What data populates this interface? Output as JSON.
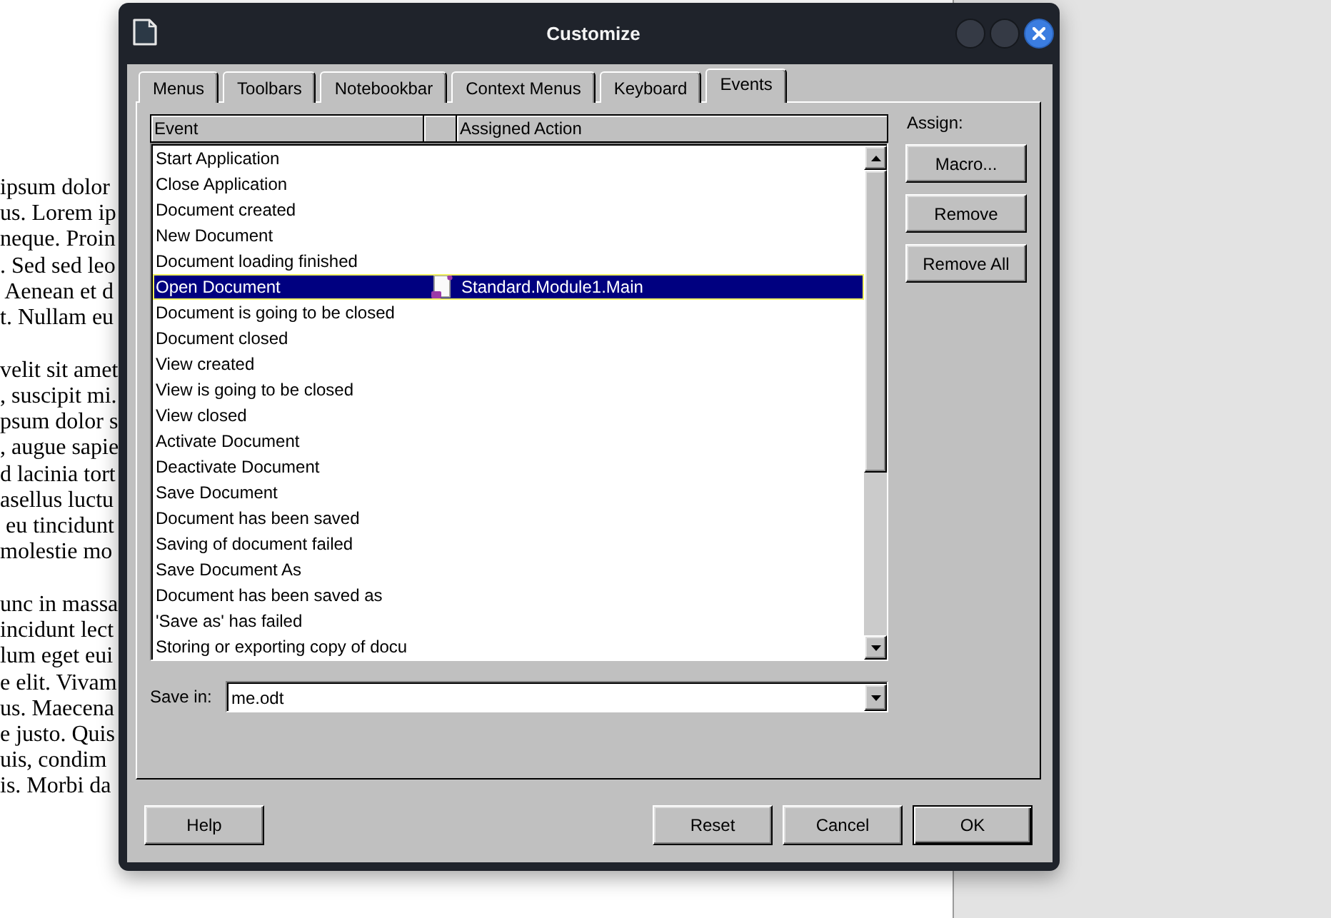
{
  "document": {
    "paragraphs": [
      [
        "ipsum dolor",
        "us. Lorem ip",
        "neque. Proin",
        ". Sed sed leo",
        " Aenean et d",
        "t. Nullam eu"
      ],
      [
        "velit sit amet",
        ", suscipit mi.",
        "psum dolor s",
        ", augue sapie",
        "d lacinia tort",
        "asellus luctu",
        " eu tincidunt",
        "molestie mo"
      ],
      [
        "unc in massa",
        "incidunt lect",
        "lum eget eui",
        "e elit. Vivam",
        "us. Maecena",
        "e justo. Quis",
        "uis, condim",
        "is. Morbi da"
      ]
    ]
  },
  "dialog": {
    "title": "Customize",
    "tabs": [
      {
        "label": "Menus",
        "selected": false
      },
      {
        "label": "Toolbars",
        "selected": false
      },
      {
        "label": "Notebookbar",
        "selected": false
      },
      {
        "label": "Context Menus",
        "selected": false
      },
      {
        "label": "Keyboard",
        "selected": false
      },
      {
        "label": "Events",
        "selected": true
      }
    ],
    "events": {
      "columns": [
        {
          "kind": "text",
          "label": "Event"
        },
        {
          "kind": "icon"
        },
        {
          "kind": "text",
          "label": "Assigned Action"
        }
      ],
      "rows": [
        {
          "event": "Start Application",
          "selected": false
        },
        {
          "event": "Close Application",
          "selected": false
        },
        {
          "event": "Document created",
          "selected": false
        },
        {
          "event": "New Document",
          "selected": false
        },
        {
          "event": "Document loading finished",
          "selected": false
        },
        {
          "event": "Open Document",
          "action": "Standard.Module1.Main",
          "selected": true
        },
        {
          "event": "Document is going to be closed",
          "selected": false
        },
        {
          "event": "Document closed",
          "selected": false
        },
        {
          "event": "View created",
          "selected": false
        },
        {
          "event": "View is going to be closed",
          "selected": false
        },
        {
          "event": "View closed",
          "selected": false
        },
        {
          "event": "Activate Document",
          "selected": false
        },
        {
          "event": "Deactivate Document",
          "selected": false
        },
        {
          "event": "Save Document",
          "selected": false
        },
        {
          "event": "Document has been saved",
          "selected": false
        },
        {
          "event": "Saving of document failed",
          "selected": false
        },
        {
          "event": "Save Document As",
          "selected": false
        },
        {
          "event": "Document has been saved as",
          "selected": false
        },
        {
          "event": "'Save as' has failed",
          "selected": false
        },
        {
          "event": "Storing or exporting copy of docu",
          "selected": false
        }
      ]
    },
    "save_in": {
      "label": "Save in:",
      "value": "me.odt"
    },
    "assign": {
      "label": "Assign:",
      "buttons": [
        {
          "label": "Macro..."
        },
        {
          "label": "Remove"
        },
        {
          "label": "Remove All"
        }
      ]
    },
    "help_button": {
      "label": "Help"
    },
    "buttons": [
      {
        "label": "Reset",
        "default": false
      },
      {
        "label": "Cancel",
        "default": false
      },
      {
        "label": "OK",
        "default": true
      }
    ]
  }
}
